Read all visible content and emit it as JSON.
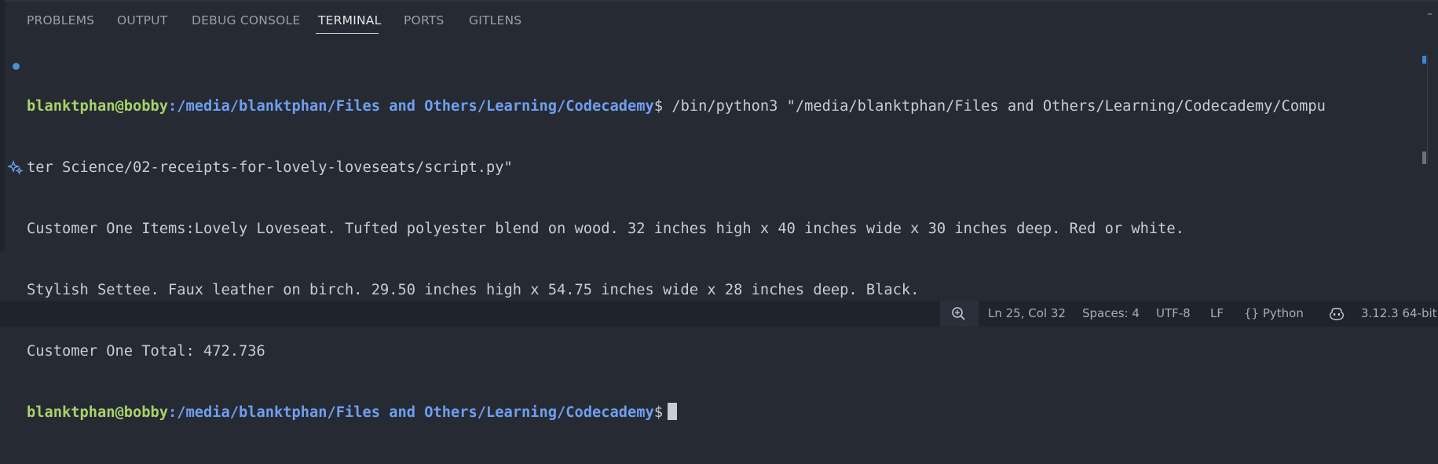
{
  "tabs": [
    {
      "label": "PROBLEMS"
    },
    {
      "label": "OUTPUT"
    },
    {
      "label": "DEBUG CONSOLE"
    },
    {
      "label": "TERMINAL",
      "active": true
    },
    {
      "label": "PORTS"
    },
    {
      "label": "GITLENS"
    }
  ],
  "terminal": {
    "prompt_user": "blanktphan@bobby",
    "prompt_path": ":/media/blanktphan/Files and Others/Learning/Codecademy",
    "prompt_symbol": "$",
    "command": " /bin/python3 \"/media/blanktphan/Files and Others/Learning/Codecademy/Compu",
    "command_wrap": "ter Science/02-receipts-for-lovely-loveseats/script.py\"",
    "output": [
      "Customer One Items:Lovely Loveseat. Tufted polyester blend on wood. 32 inches high x 40 inches wide x 30 inches deep. Red or white.",
      "Stylish Settee. Faux leather on birch. 29.50 inches high x 54.75 inches wide x 28 inches deep. Black.",
      "Customer One Total: 472.736"
    ]
  },
  "statusbar": {
    "zoom_icon": "zoom-in-icon",
    "position": "Ln 25, Col 32",
    "spaces": "Spaces: 4",
    "encoding": "UTF-8",
    "eol": "LF",
    "language_braces": "{}",
    "language": "Python",
    "copilot_icon": "copilot-icon",
    "interpreter": "3.12.3 64-bit"
  },
  "colors": {
    "background": "#262a33",
    "user": "#a8d26b",
    "path": "#6f9ff0",
    "text": "#c8ccd4",
    "decoration": "#4a8fd8"
  }
}
